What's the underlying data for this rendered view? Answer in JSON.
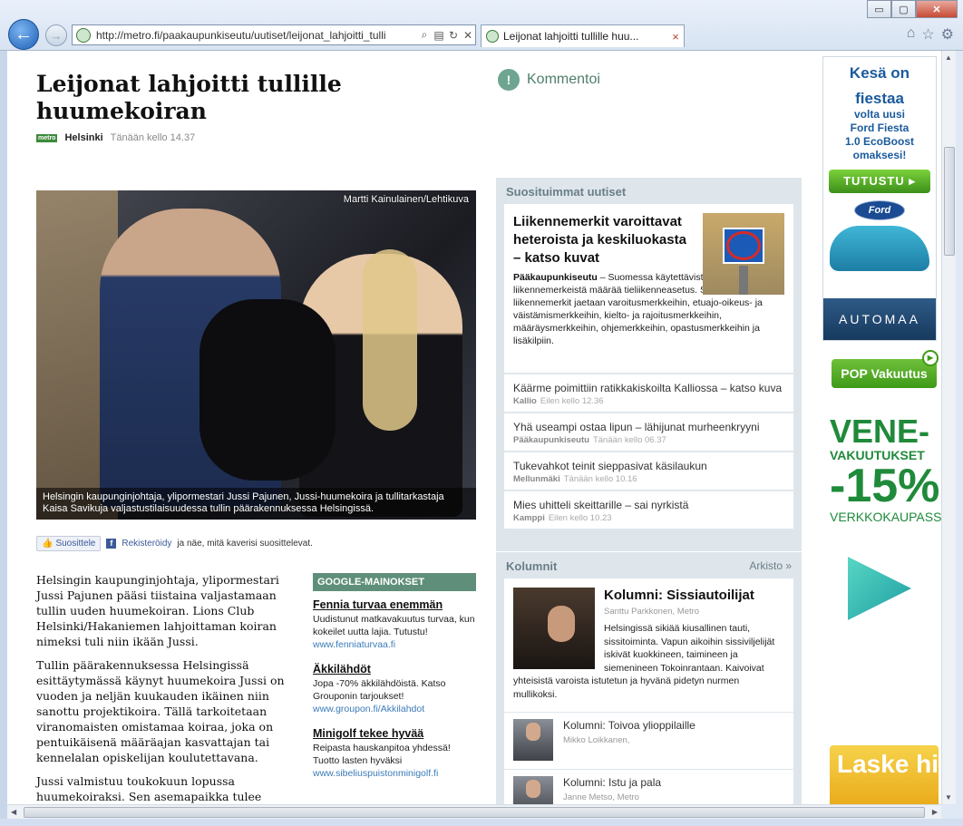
{
  "browser": {
    "url": "http://metro.fi/paakaupunkiseutu/uutiset/leijonat_lahjoitti_tulli",
    "tab_title": "Leijonat lahjoitti tullille huu...",
    "tab_close": "×",
    "win_minimize": "▭",
    "win_maximize": "▢",
    "win_close": "✕",
    "back_glyph": "←",
    "forward_glyph": "→",
    "home_glyph": "⌂",
    "favorites_glyph": "☆",
    "tools_glyph": "⚙",
    "search_glyph": "⌕",
    "compat_glyph": "▤",
    "refresh_glyph": "↻",
    "stop_glyph": "✕",
    "icons": [
      "back-arrow-icon",
      "forward-arrow-icon",
      "globe-icon",
      "search-icon",
      "refresh-icon",
      "stop-icon",
      "home-icon",
      "star-icon",
      "gear-icon"
    ]
  },
  "article": {
    "headline": "Leijonat lahjoitti tullille huumekoiran",
    "metro_logo": "metro",
    "location": "Helsinki",
    "time": "Tänään kello 14.37",
    "comment_icon": "!",
    "comment_label": "Kommentoi",
    "photo_credit": "Martti Kainulainen/Lehtikuva",
    "photo_caption": "Helsingin kaupunginjohtaja, ylipormestari Jussi Pajunen, Jussi-huumekoira ja tullitarkastaja Kaisa Savikuja valjastustilaisuudessa tullin päärakennuksessa Helsingissä.",
    "like_label": "Suosittele",
    "fb_icon": "f",
    "register_link": "Rekisteröidy",
    "register_rest": "ja näe, mitä kaverisi suosittelevat.",
    "paragraphs": [
      "Helsingin kaupunginjohtaja, ylipormestari Jussi Pajunen pääsi tiistaina valjastamaan tullin uuden huumekoiran. Lions Club Helsinki/Hakaniemen lahjoittaman koiran nimeksi tuli niin ikään Jussi.",
      "Tullin päärakennuksessa Helsingissä esittäytymässä käynyt huumekoira Jussi on vuoden ja neljän kuukauden ikäinen niin sanottu projektikoira. Tällä tarkoitetaan viranomaisten omistamaa koiraa, joka on pentuikäisenä määräajan kasvattajan tai kennelalan opiskelijan koulutettavana.",
      "Jussi valmistuu toukokuun lopussa huumekoiraksi. Sen asemapaikka tulee olemaan"
    ]
  },
  "google_ads": {
    "header": "GOOGLE-MAINOKSET",
    "items": [
      {
        "title": "Fennia turvaa enemmän",
        "desc": "Uudistunut matkavakuutus turvaa, kun kokeilet uutta lajia. Tutustu!",
        "url": "www.fenniaturvaa.fi"
      },
      {
        "title": "Äkkilähdöt",
        "desc": "Jopa -70% äkkilähdöistä. Katso Grouponin tarjoukset!",
        "url": "www.groupon.fi/Akkilahdot"
      },
      {
        "title": "Minigolf tekee hyvää",
        "desc": "Reipasta hauskanpitoa yhdessä! Tuotto lasten hyväksi",
        "url": "www.sibeliuspuistonminigolf.fi"
      }
    ]
  },
  "popular": {
    "title": "Suosituimmat uutiset",
    "featured": {
      "title": "Liikennemerkit varoittavat heteroista ja keskiluokasta – katso kuvat",
      "lead_loc": "Pääkaupunkiseutu",
      "lead_text": " – Suomessa käytettävistä liikennemerkeistä määrää tieliikenneasetus. Sen mukaan liikennemerkit jaetaan varoitusmerkkeihin, etuajo-oikeus- ja väistämismerkkeihin, kielto- ja rajoitusmerkkeihin, määräysmerkkeihin, ohjemerkkeihin, opastusmerkkeihin ja lisäkilpiin."
    },
    "items": [
      {
        "title": "Käärme poimittiin ratikkakiskoilta Kalliossa – katso kuva",
        "loc": "Kallio",
        "time": "Eilen kello 12.36"
      },
      {
        "title": "Yhä useampi ostaa lipun – lähijunat murheenkryyni",
        "loc": "Pääkaupunkiseutu",
        "time": "Tänään kello 06.37"
      },
      {
        "title": "Tukevahkot teinit sieppasivat käsilaukun",
        "loc": "Mellunmäki",
        "time": "Tänään kello 10.16"
      },
      {
        "title": "Mies uhitteli skeittarille – sai nyrkistä",
        "loc": "Kamppi",
        "time": "Eilen kello 10.23"
      }
    ]
  },
  "columns": {
    "title": "Kolumnit",
    "archive": "Arkisto »",
    "main": {
      "title": "Kolumni: Sissiautoilijat",
      "author": "Santtu Parkkonen, Metro",
      "text_a": "Helsingissä sikiää kiusallinen tauti, sissitoiminta. Vapun aikoihin sissiviljelijät iskivät kuokkineen, taimineen ja siemenineen Tokoinrantaan. Kaivoivat",
      "text_b": "yhteisistä varoista istutetun ja hyvänä pidetyn nurmen mullikoksi."
    },
    "items": [
      {
        "title": "Kolumni: Toivoa ylioppilaille",
        "author": "Mikko Loikkanen,"
      },
      {
        "title": "Kolumni: Istu ja pala",
        "author": "Janne Metso, Metro"
      }
    ]
  },
  "ford_ad": {
    "line1": "Kesä on",
    "line2": "fiestaa",
    "line3": "volta uusi",
    "line4": "Ford Fiesta",
    "line5": "1.0 EcoBoost",
    "line6": "omaksesi!",
    "button": "TUTUSTU ▸",
    "logo": "Ford",
    "dealer": "AUTOMAA"
  },
  "pop_ad": {
    "logo": "POP Vakuutus",
    "play": "▶",
    "big": "VENE-",
    "mid": "VAKUUTUKSET",
    "pct": "-15%",
    "small": "VERKKOKAUPASSA",
    "calc": "Laske hinta"
  },
  "colors": {
    "accent_green": "#5f8f7a",
    "sidebar_bg": "#dee6ec",
    "link_blue": "#3b7bb8"
  }
}
